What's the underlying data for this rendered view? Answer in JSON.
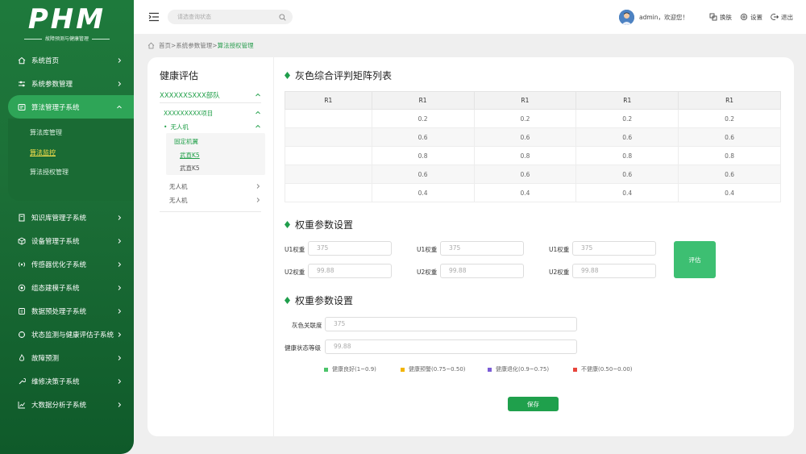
{
  "brand": {
    "logo": "PHM",
    "subtitle": "故障预测与健康管理"
  },
  "sidebar": {
    "items": [
      {
        "label": "系统首页",
        "icon": "home-icon"
      },
      {
        "label": "系统参数管理",
        "icon": "sliders-icon"
      },
      {
        "label": "算法管理子系统",
        "icon": "algorithm-icon",
        "active": true
      },
      {
        "label": "知识库管理子系统",
        "icon": "book-icon"
      },
      {
        "label": "设备管理子系统",
        "icon": "cube-icon"
      },
      {
        "label": "传感器优化子系统",
        "icon": "signal-icon"
      },
      {
        "label": "组态建模子系统",
        "icon": "target-icon"
      },
      {
        "label": "数据预处理子系统",
        "icon": "data-icon"
      },
      {
        "label": "状态监测与健康评估子系统",
        "icon": "monitor-icon"
      },
      {
        "label": "故障预测",
        "icon": "fire-icon"
      },
      {
        "label": "维修决策子系统",
        "icon": "wrench-icon"
      },
      {
        "label": "大数据分析子系统",
        "icon": "chart-icon"
      }
    ],
    "subitems": [
      {
        "label": "算法库管理"
      },
      {
        "label": "算法监控",
        "active": true
      },
      {
        "label": "算法授权管理"
      }
    ]
  },
  "topbar": {
    "search_placeholder": "请选查询状态",
    "welcome": "admin，欢迎您！",
    "skin": "换肤",
    "settings": "设置",
    "logout": "退出"
  },
  "breadcrumb": {
    "home": "首页",
    "sep": ">",
    "level1": "系统参数管理",
    "current": "算法授权管理"
  },
  "tree": {
    "title": "健康评估",
    "unit": "XXXXXXSXXX部队",
    "project": "XXXXXXXXX项目",
    "uav1": "无人机",
    "fixed_wing": "固定机翼",
    "wuzhen_active": "武直K5",
    "wuzhen": "武直K5",
    "uav2": "无人机",
    "uav3": "无人机"
  },
  "matrix": {
    "title": "灰色综合评判矩阵列表",
    "headers": [
      "R1",
      "R1",
      "R1",
      "R1",
      "R1"
    ],
    "rows": [
      [
        "",
        "0.2",
        "0.2",
        "0.2",
        "0.2"
      ],
      [
        "",
        "0.6",
        "0.6",
        "0.6",
        "0.6"
      ],
      [
        "",
        "0.8",
        "0.8",
        "0.8",
        "0.8"
      ],
      [
        "",
        "0.6",
        "0.6",
        "0.6",
        "0.6"
      ],
      [
        "",
        "0.4",
        "0.4",
        "0.4",
        "0.4"
      ]
    ]
  },
  "weights": {
    "title": "权重参数设置",
    "u1_label": "U1权重",
    "u2_label": "U2权重",
    "u1_value": "375",
    "u2_value": "99.88",
    "eval_button": "评估"
  },
  "weights2": {
    "title": "权重参数设置",
    "grey_label": "灰色关联度",
    "grey_value": "375",
    "health_label": "健康状态等级",
    "health_value": "99.88",
    "legend": [
      {
        "label": "健康良好(1~0.9)",
        "color": "#4cc46a"
      },
      {
        "label": "健康预警(0.75~0.50)",
        "color": "#f2b400"
      },
      {
        "label": "健康退化(0.9~0.75)",
        "color": "#7b5cd6"
      },
      {
        "label": "不健康(0.50~0.00)",
        "color": "#e8453c"
      }
    ],
    "save_button": "保存"
  }
}
